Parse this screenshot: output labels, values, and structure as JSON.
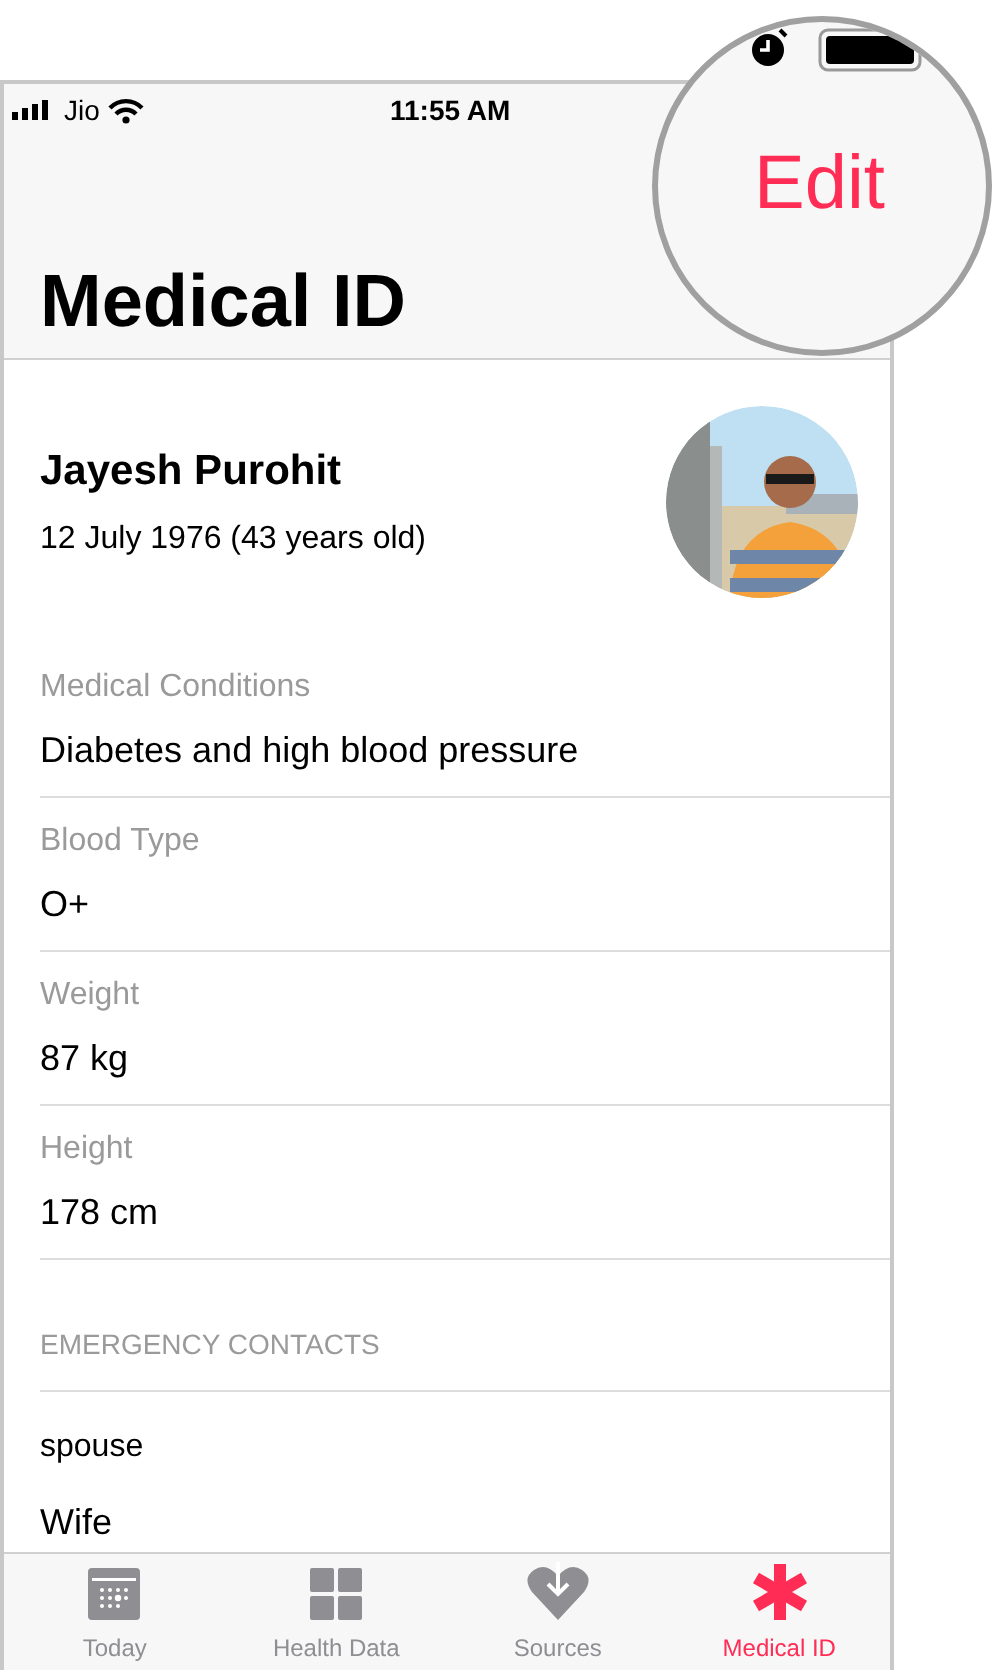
{
  "status_bar": {
    "carrier": "Jio",
    "time": "11:55 AM"
  },
  "nav": {
    "title": "Medical ID",
    "edit": "Edit"
  },
  "profile": {
    "name": "Jayesh Purohit",
    "birth": "12 July 1976 (43 years old)"
  },
  "fields": [
    {
      "label": "Medical Conditions",
      "value": "Diabetes and high blood pressure"
    },
    {
      "label": "Blood Type",
      "value": "O+"
    },
    {
      "label": "Weight",
      "value": "87 kg"
    },
    {
      "label": "Height",
      "value": "178 cm"
    }
  ],
  "emergency_contacts": {
    "header": "EMERGENCY CONTACTS",
    "contacts": [
      {
        "relationship": "spouse",
        "name": "Wife"
      }
    ]
  },
  "tabs": [
    {
      "label": "Today",
      "kind": "today",
      "selected": false
    },
    {
      "label": "Health Data",
      "kind": "grid",
      "selected": false
    },
    {
      "label": "Sources",
      "kind": "sources",
      "selected": false
    },
    {
      "label": "Medical ID",
      "kind": "medical",
      "selected": true
    }
  ]
}
